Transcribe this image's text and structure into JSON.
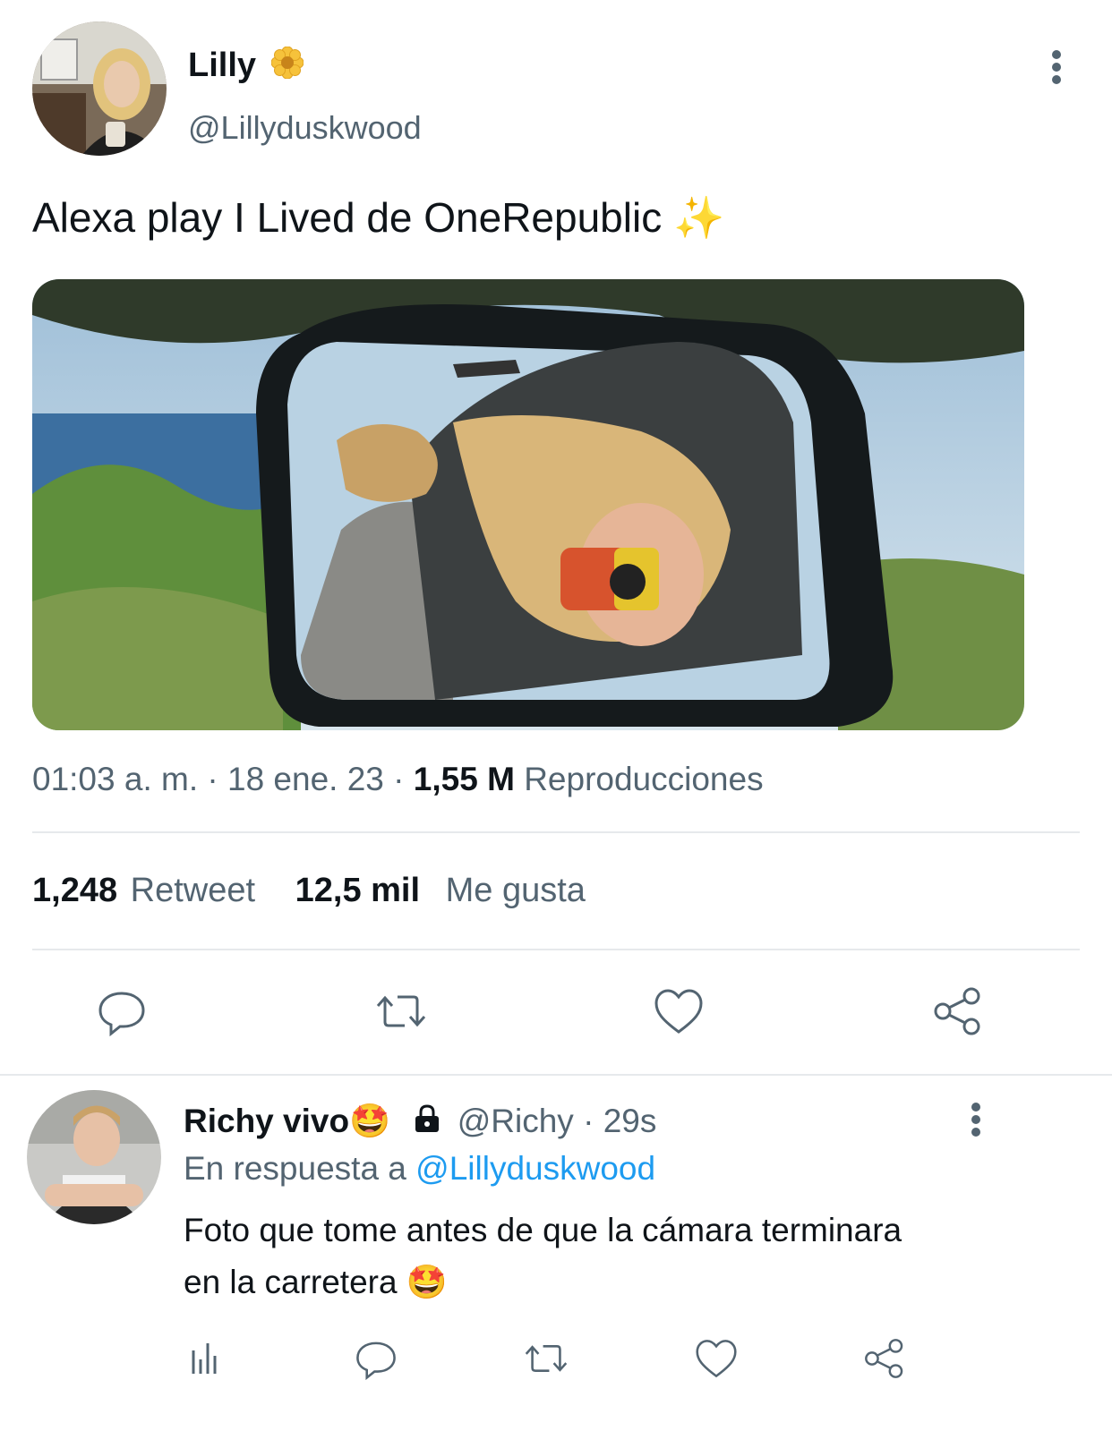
{
  "tweet": {
    "author_name": "Lilly",
    "author_badge_icon": "flower-emoji",
    "author_handle": "@Lillyduskwood",
    "text": "Alexa play I Lived de OneRepublic",
    "text_emoji": "✨",
    "media_description_icon": "photo-car-mirror",
    "meta": {
      "time": "01:03 a. m.",
      "sep1": "·",
      "date": "18 ene. 23",
      "sep2": "·",
      "views_count": "1,55 M",
      "views_label": "Reproducciones"
    },
    "stats": {
      "retweets_count": "1,248",
      "retweets_label": "Retweet",
      "likes_count": "12,5 mil",
      "likes_label": "Me gusta"
    }
  },
  "reply": {
    "author_name": "Richy vivo",
    "author_emoji": "🤩",
    "lock_icon": "lock-icon",
    "author_handle": "@Richy",
    "sep": "·",
    "time": "29s",
    "reply_prefix": "En respuesta a",
    "reply_to": "@Lillyduskwood",
    "text_line1": "Foto que tome antes de que la cámara terminara",
    "text_line2": "en la carretera",
    "text_emoji": "🤩"
  },
  "colors": {
    "text": "#0f1419",
    "secondary": "#536471",
    "link": "#1d9bf0",
    "divider": "#e6e9ec"
  }
}
